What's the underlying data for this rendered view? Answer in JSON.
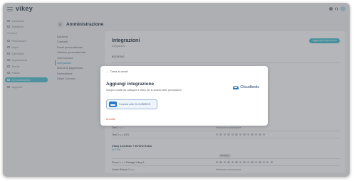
{
  "app": {
    "logo": "vikey"
  },
  "sidebar": {
    "items": [
      {
        "label": "Dashboard",
        "icon": "dashboard-icon"
      },
      {
        "label": "Statistiche",
        "icon": "chart-icon"
      }
    ],
    "section": "Gestione",
    "items2": [
      {
        "label": "Prenotazioni",
        "icon": "calendar-icon"
      },
      {
        "label": "Ospiti",
        "icon": "guests-icon"
      },
      {
        "label": "Calendario",
        "icon": "calendar-icon"
      },
      {
        "label": "Appartamenti",
        "icon": "home-icon"
      },
      {
        "label": "Servizi",
        "icon": "services-icon"
      },
      {
        "label": "Fatture",
        "icon": "invoice-icon"
      },
      {
        "label": "Amministrazione",
        "icon": "settings-icon",
        "active": true
      },
      {
        "label": "Supporto",
        "icon": "support-icon"
      }
    ]
  },
  "admin": {
    "title": "Amministrazione"
  },
  "submenu": [
    {
      "label": "Bacheca"
    },
    {
      "label": "Contratti"
    },
    {
      "label": "Email personalizzate"
    },
    {
      "label": "Checkin personalizzato"
    },
    {
      "label": "Sub-Account"
    },
    {
      "label": "Integrazioni",
      "selected": true
    },
    {
      "label": "Metodi di pagamento"
    },
    {
      "label": "Fatturazione"
    },
    {
      "label": "Stripe Connect"
    }
  ],
  "card": {
    "title": "Integrazioni",
    "subtitle": "Integrazioni",
    "add_button": "Aggiungi integrazione",
    "booking_label": "BOOKING",
    "rows_top": [
      {
        "name": "Test 1 <-> ...",
        "status": "Nessuna connessione"
      },
      {
        "name": "Test 2 <-> icTD",
        "status": ""
      }
    ],
    "group": {
      "title": "Vikey 114 2021 + EVIVO Extra",
      "subtitle": "ACTIVE",
      "pill": "Booking"
    },
    "rows_bottom": [
      {
        "name": "Room 1 <-> Partage Vikey A",
        "status": ""
      },
      {
        "name": "Junior Deluxe 1 <-> ...",
        "status": "Nessuna connessione"
      }
    ]
  },
  "modal": {
    "back_label": "Torna ai canali",
    "title": "Aggiungi integrazione",
    "description": "Scegli il canale da collegare a Vikey per lo scarico delle prenotazioni",
    "provider_logo_text": "Cloudbeds",
    "connect_button": "Connect with CLOUDBEDS",
    "cancel": "Annulla"
  },
  "colors": {
    "accent": "#4ec3d3",
    "brand_blue": "#2a79c4",
    "danger": "#d9534f"
  }
}
